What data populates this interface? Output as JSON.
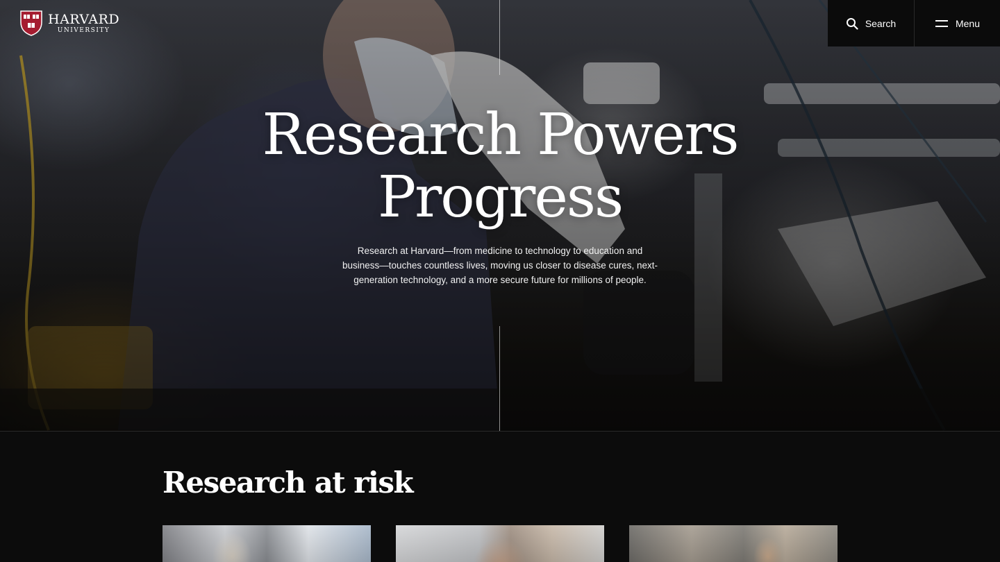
{
  "header": {
    "logo_name": "HARVARD",
    "logo_sub": "UNIVERSITY",
    "search_label": "Search",
    "menu_label": "Menu"
  },
  "hero": {
    "title_line1": "Research Powers",
    "title_line2": "Progress",
    "description": "Research at Harvard—from medicine to technology to education and business—touches countless lives, moving us closer to disease cures, next-generation technology, and a more secure future for millions of people."
  },
  "section": {
    "title": "Research at risk"
  },
  "colors": {
    "background": "#0c0c0c",
    "crimson": "#a51c30",
    "text": "#ffffff"
  },
  "icons": [
    "harvard-shield-icon",
    "search-icon",
    "menu-icon"
  ]
}
